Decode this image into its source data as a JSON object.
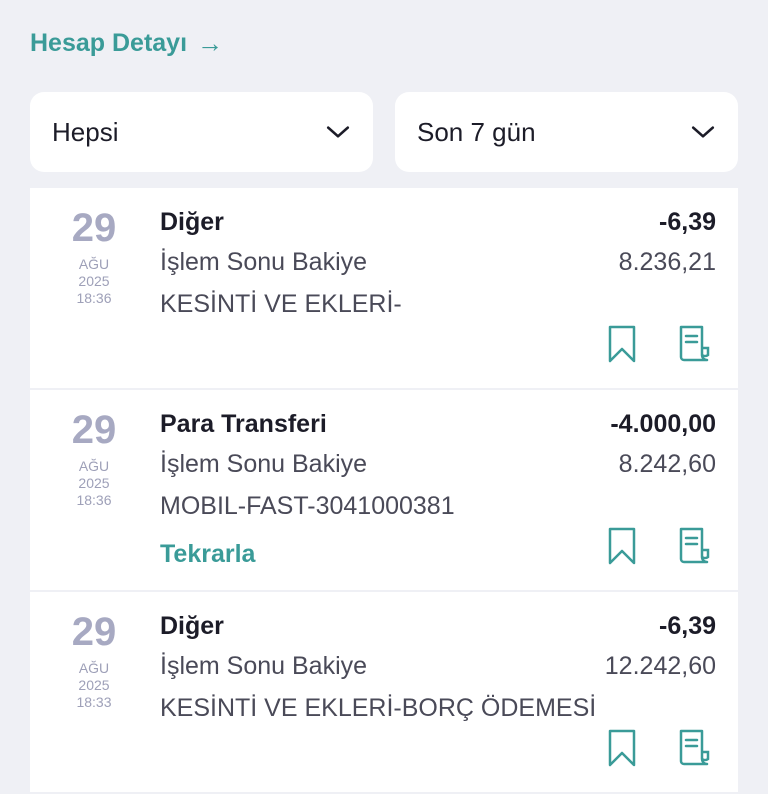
{
  "header": {
    "title": "Hesap Detayı",
    "arrow": "→"
  },
  "filters": {
    "type": "Hepsi",
    "period": "Son 7 gün"
  },
  "transactions": [
    {
      "day": "29",
      "month": "AĞU",
      "year": "2025",
      "time": "18:36",
      "title": "Diğer",
      "amount": "-6,39",
      "balance_label": "İşlem Sonu Bakiye",
      "balance": "8.236,21",
      "description": "KESİNTİ VE EKLERİ-"
    },
    {
      "day": "29",
      "month": "AĞU",
      "year": "2025",
      "time": "18:36",
      "title": "Para Transferi",
      "amount": "-4.000,00",
      "balance_label": "İşlem Sonu Bakiye",
      "balance": "8.242,60",
      "description": "MOBIL-FAST-3041000381",
      "action": "Tekrarla"
    },
    {
      "day": "29",
      "month": "AĞU",
      "year": "2025",
      "time": "18:33",
      "title": "Diğer",
      "amount": "-6,39",
      "balance_label": "İşlem Sonu Bakiye",
      "balance": "12.242,60",
      "description": "KESİNTİ VE EKLERİ-BORÇ ÖDEMESİ"
    }
  ],
  "colors": {
    "accent": "#3a9b98",
    "background": "#eff0f5",
    "date": "#a7a9c2"
  },
  "icons": {
    "bookmark": "bookmark-icon",
    "receipt": "receipt-icon",
    "chevron": "chevron-down-icon",
    "arrow": "arrow-right-icon"
  }
}
